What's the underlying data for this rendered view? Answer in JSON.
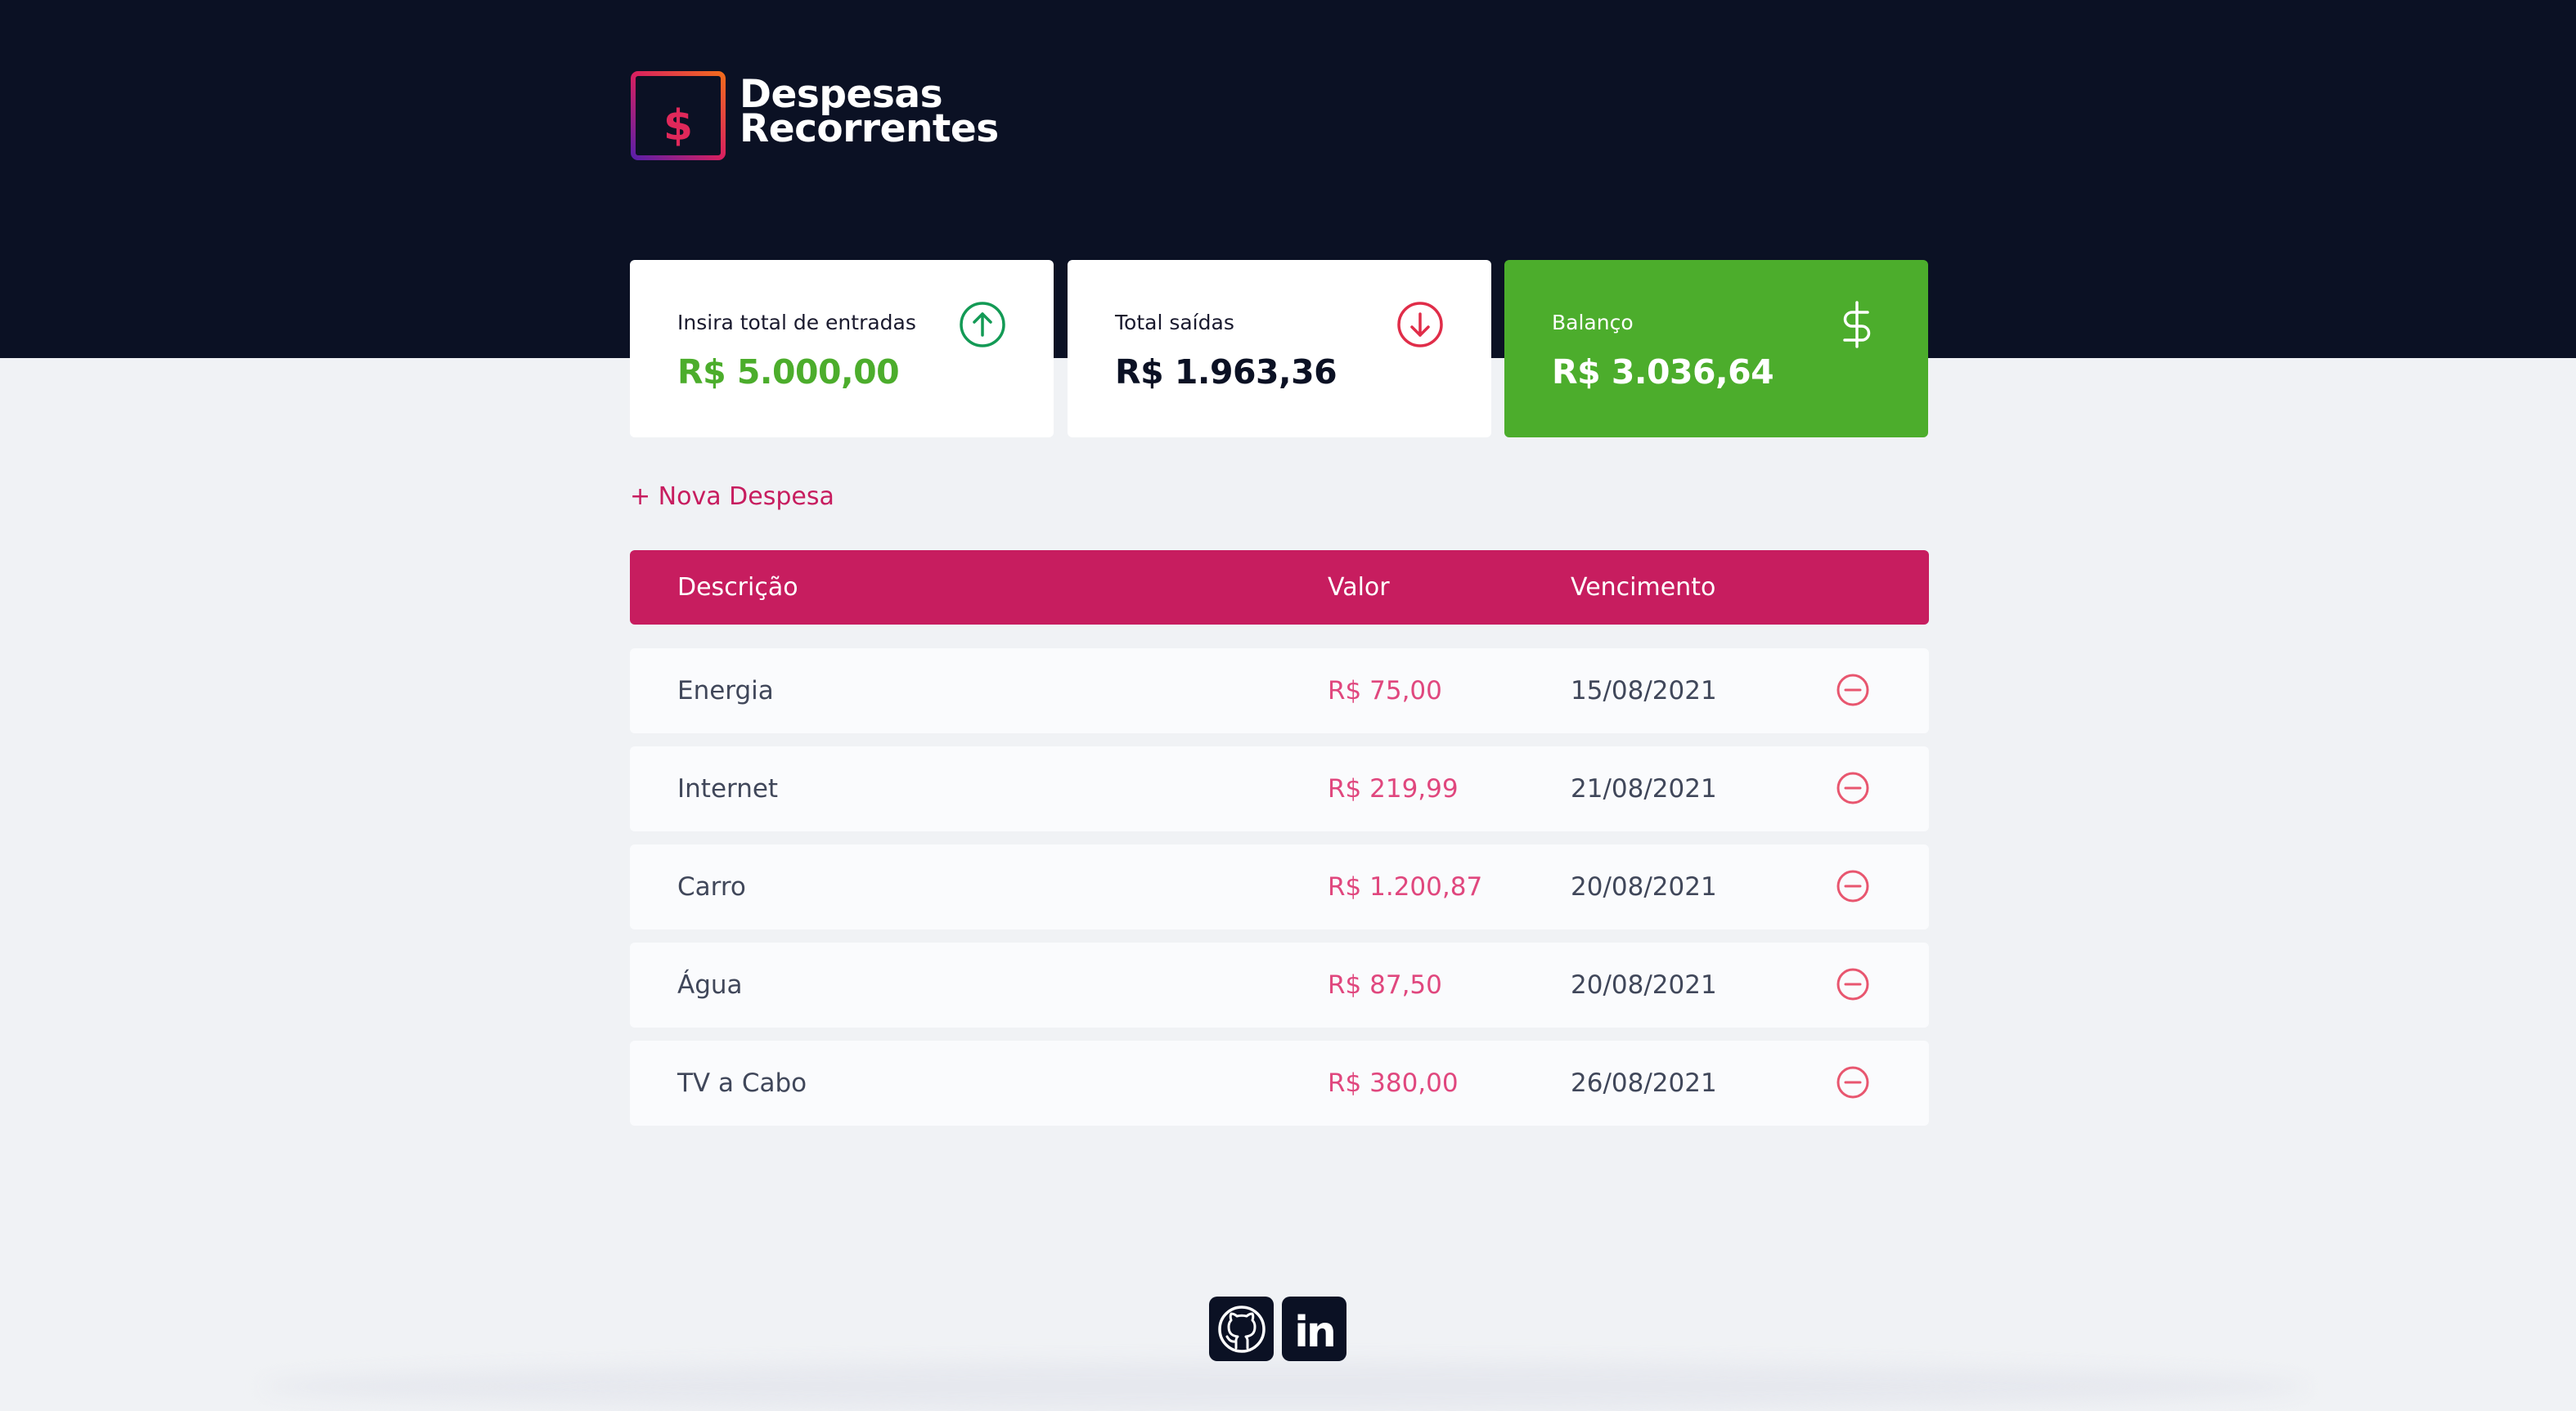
{
  "app": {
    "title_line1": "Despesas",
    "title_line2": "Recorrentes"
  },
  "summary": {
    "income": {
      "label": "Insira total de entradas",
      "value": "R$ 5.000,00",
      "icon": "arrow-up-circle-icon"
    },
    "expenses": {
      "label": "Total saídas",
      "value": "R$ 1.963,36",
      "icon": "arrow-down-circle-icon"
    },
    "balance": {
      "label": "Balanço",
      "value": "R$ 3.036,64",
      "icon": "dollar-icon"
    }
  },
  "actions": {
    "new_expense": "+ Nova Despesa"
  },
  "table": {
    "headers": [
      "Descrição",
      "Valor",
      "Vencimento"
    ],
    "rows": [
      {
        "description": "Energia",
        "value": "R$ 75,00",
        "due": "15/08/2021"
      },
      {
        "description": "Internet",
        "value": "R$ 219,99",
        "due": "21/08/2021"
      },
      {
        "description": "Carro",
        "value": "R$ 1.200,87",
        "due": "20/08/2021"
      },
      {
        "description": "Água",
        "value": "R$ 87,50",
        "due": "20/08/2021"
      },
      {
        "description": "TV a Cabo",
        "value": "R$ 380,00",
        "due": "26/08/2021"
      }
    ]
  },
  "footer": {
    "links": [
      "github-icon",
      "linkedin-icon"
    ],
    "linkedin_glyph": "in"
  },
  "colors": {
    "header_bg": "#0b1124",
    "accent": "#c71d5f",
    "income_green": "#4cad2c",
    "expense_red": "#e0477e"
  }
}
